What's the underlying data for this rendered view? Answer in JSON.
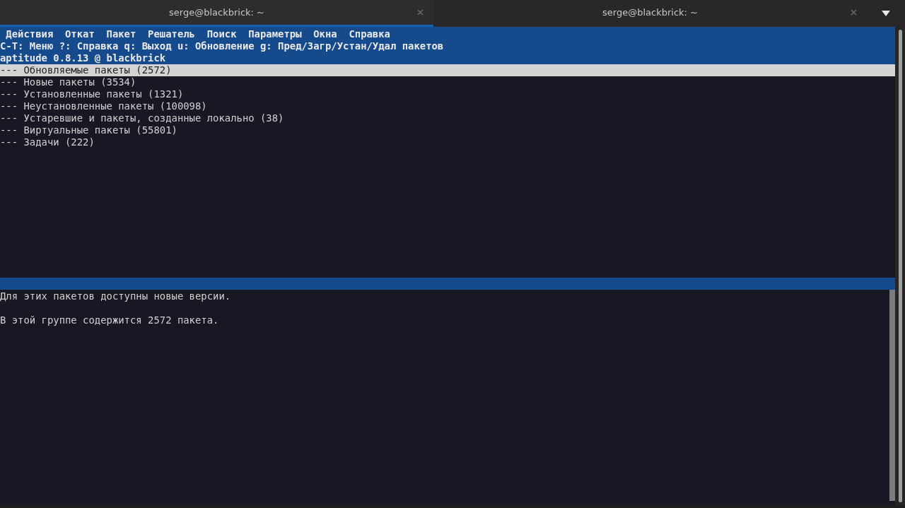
{
  "tabs": [
    {
      "title": "serge@blackbrick: ~",
      "selected": true
    },
    {
      "title": "serge@blackbrick: ~",
      "selected": false
    }
  ],
  "terminal": {
    "menu": [
      "Действия",
      "Откат",
      "Пакет",
      "Решатель",
      "Поиск",
      "Параметры",
      "Окна",
      "Справка"
    ],
    "hint": "C-T: Меню ?: Справка q: Выход u: Обновление g: Пред/Загр/Устан/Удал пакетов",
    "title": "aptitude 0.8.13 @ blackbrick",
    "items": [
      {
        "text": "--- Обновляемые пакеты (2572)",
        "selected": true
      },
      {
        "text": "--- Новые пакеты (3534)",
        "selected": false
      },
      {
        "text": "--- Установленные пакеты (1321)",
        "selected": false
      },
      {
        "text": "--- Неустановленные пакеты (100098)",
        "selected": false
      },
      {
        "text": "--- Устаревшие и пакеты, созданные локально (38)",
        "selected": false
      },
      {
        "text": "--- Виртуальные пакеты (55801)",
        "selected": false
      },
      {
        "text": "--- Задачи (222)",
        "selected": false
      }
    ],
    "description": [
      "Для этих пакетов доступны новые версии.",
      "В этой группе содержится 2572 пакета."
    ]
  }
}
